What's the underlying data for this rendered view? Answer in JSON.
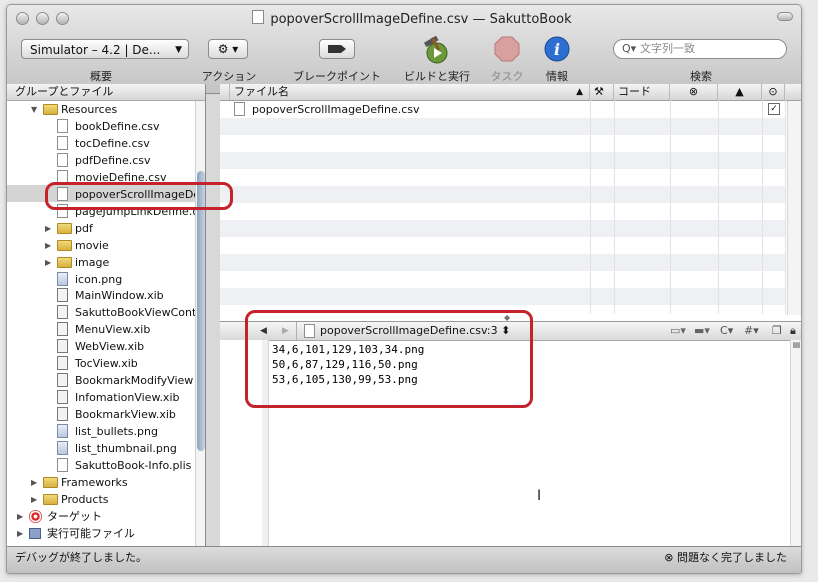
{
  "window": {
    "title": "popoverScrollImageDefine.csv — SakuttoBook"
  },
  "toolbar": {
    "scheme_popup": "Simulator – 4.2 | De...",
    "overview_label": "概要",
    "action_label": "アクション",
    "breakpoint_label": "ブレークポイント",
    "build_run_label": "ビルドと実行",
    "tasks_label": "タスク",
    "info_label": "情報",
    "search_placeholder": "文字列一致",
    "search_label": "検索"
  },
  "sidebar": {
    "header": "グループとファイル",
    "items": [
      {
        "label": "Resources",
        "type": "folder",
        "indent": 2,
        "expanded": true
      },
      {
        "label": "bookDefine.csv",
        "type": "file",
        "indent": 3
      },
      {
        "label": "tocDefine.csv",
        "type": "file",
        "indent": 3
      },
      {
        "label": "pdfDefine.csv",
        "type": "file",
        "indent": 3
      },
      {
        "label": "movieDefine.csv",
        "type": "file",
        "indent": 3
      },
      {
        "label": "popoverScrollImageDe",
        "type": "file",
        "indent": 3,
        "selected": true
      },
      {
        "label": "pageJumpLinkDefine.c",
        "type": "file",
        "indent": 3
      },
      {
        "label": "pdf",
        "type": "folder",
        "indent": 3,
        "expanded": false
      },
      {
        "label": "movie",
        "type": "folder",
        "indent": 3,
        "expanded": false
      },
      {
        "label": "image",
        "type": "folder",
        "indent": 3,
        "expanded": false
      },
      {
        "label": "icon.png",
        "type": "png",
        "indent": 3
      },
      {
        "label": "MainWindow.xib",
        "type": "xib",
        "indent": 3
      },
      {
        "label": "SakuttoBookViewCont",
        "type": "xib",
        "indent": 3
      },
      {
        "label": "MenuView.xib",
        "type": "xib",
        "indent": 3
      },
      {
        "label": "WebView.xib",
        "type": "xib",
        "indent": 3
      },
      {
        "label": "TocView.xib",
        "type": "xib",
        "indent": 3
      },
      {
        "label": "BookmarkModifyView",
        "type": "xib",
        "indent": 3
      },
      {
        "label": "InfomationView.xib",
        "type": "xib",
        "indent": 3
      },
      {
        "label": "BookmarkView.xib",
        "type": "xib",
        "indent": 3
      },
      {
        "label": "list_bullets.png",
        "type": "png",
        "indent": 3
      },
      {
        "label": "list_thumbnail.png",
        "type": "png",
        "indent": 3
      },
      {
        "label": "SakuttoBook-Info.plis",
        "type": "file",
        "indent": 3
      },
      {
        "label": "Frameworks",
        "type": "folder",
        "indent": 2,
        "expanded": false
      },
      {
        "label": "Products",
        "type": "folder",
        "indent": 2,
        "expanded": false
      },
      {
        "label": "ターゲット",
        "type": "target",
        "indent": 1,
        "expanded": false
      },
      {
        "label": "実行可能ファイル",
        "type": "app",
        "indent": 1,
        "expanded": false
      }
    ]
  },
  "file_list": {
    "columns": {
      "name": "ファイル名",
      "code": "コード"
    },
    "rows": [
      {
        "name": "popoverScrollImageDefine.csv",
        "checked": true
      }
    ]
  },
  "editor": {
    "file_popup": "popoverScrollImageDefine.csv:3",
    "lines": [
      "34,6,101,129,103,34.png",
      "50,6,87,129,116,50.png",
      "53,6,105,130,99,53.png"
    ],
    "tool_c": "C",
    "tool_hash": "#"
  },
  "status": {
    "left": "デバッグが終了しました。",
    "right": "問題なく完了しました"
  },
  "colors": {
    "highlight": "#c5232b",
    "stop": "#d9534f",
    "info": "#2d6fd0"
  }
}
